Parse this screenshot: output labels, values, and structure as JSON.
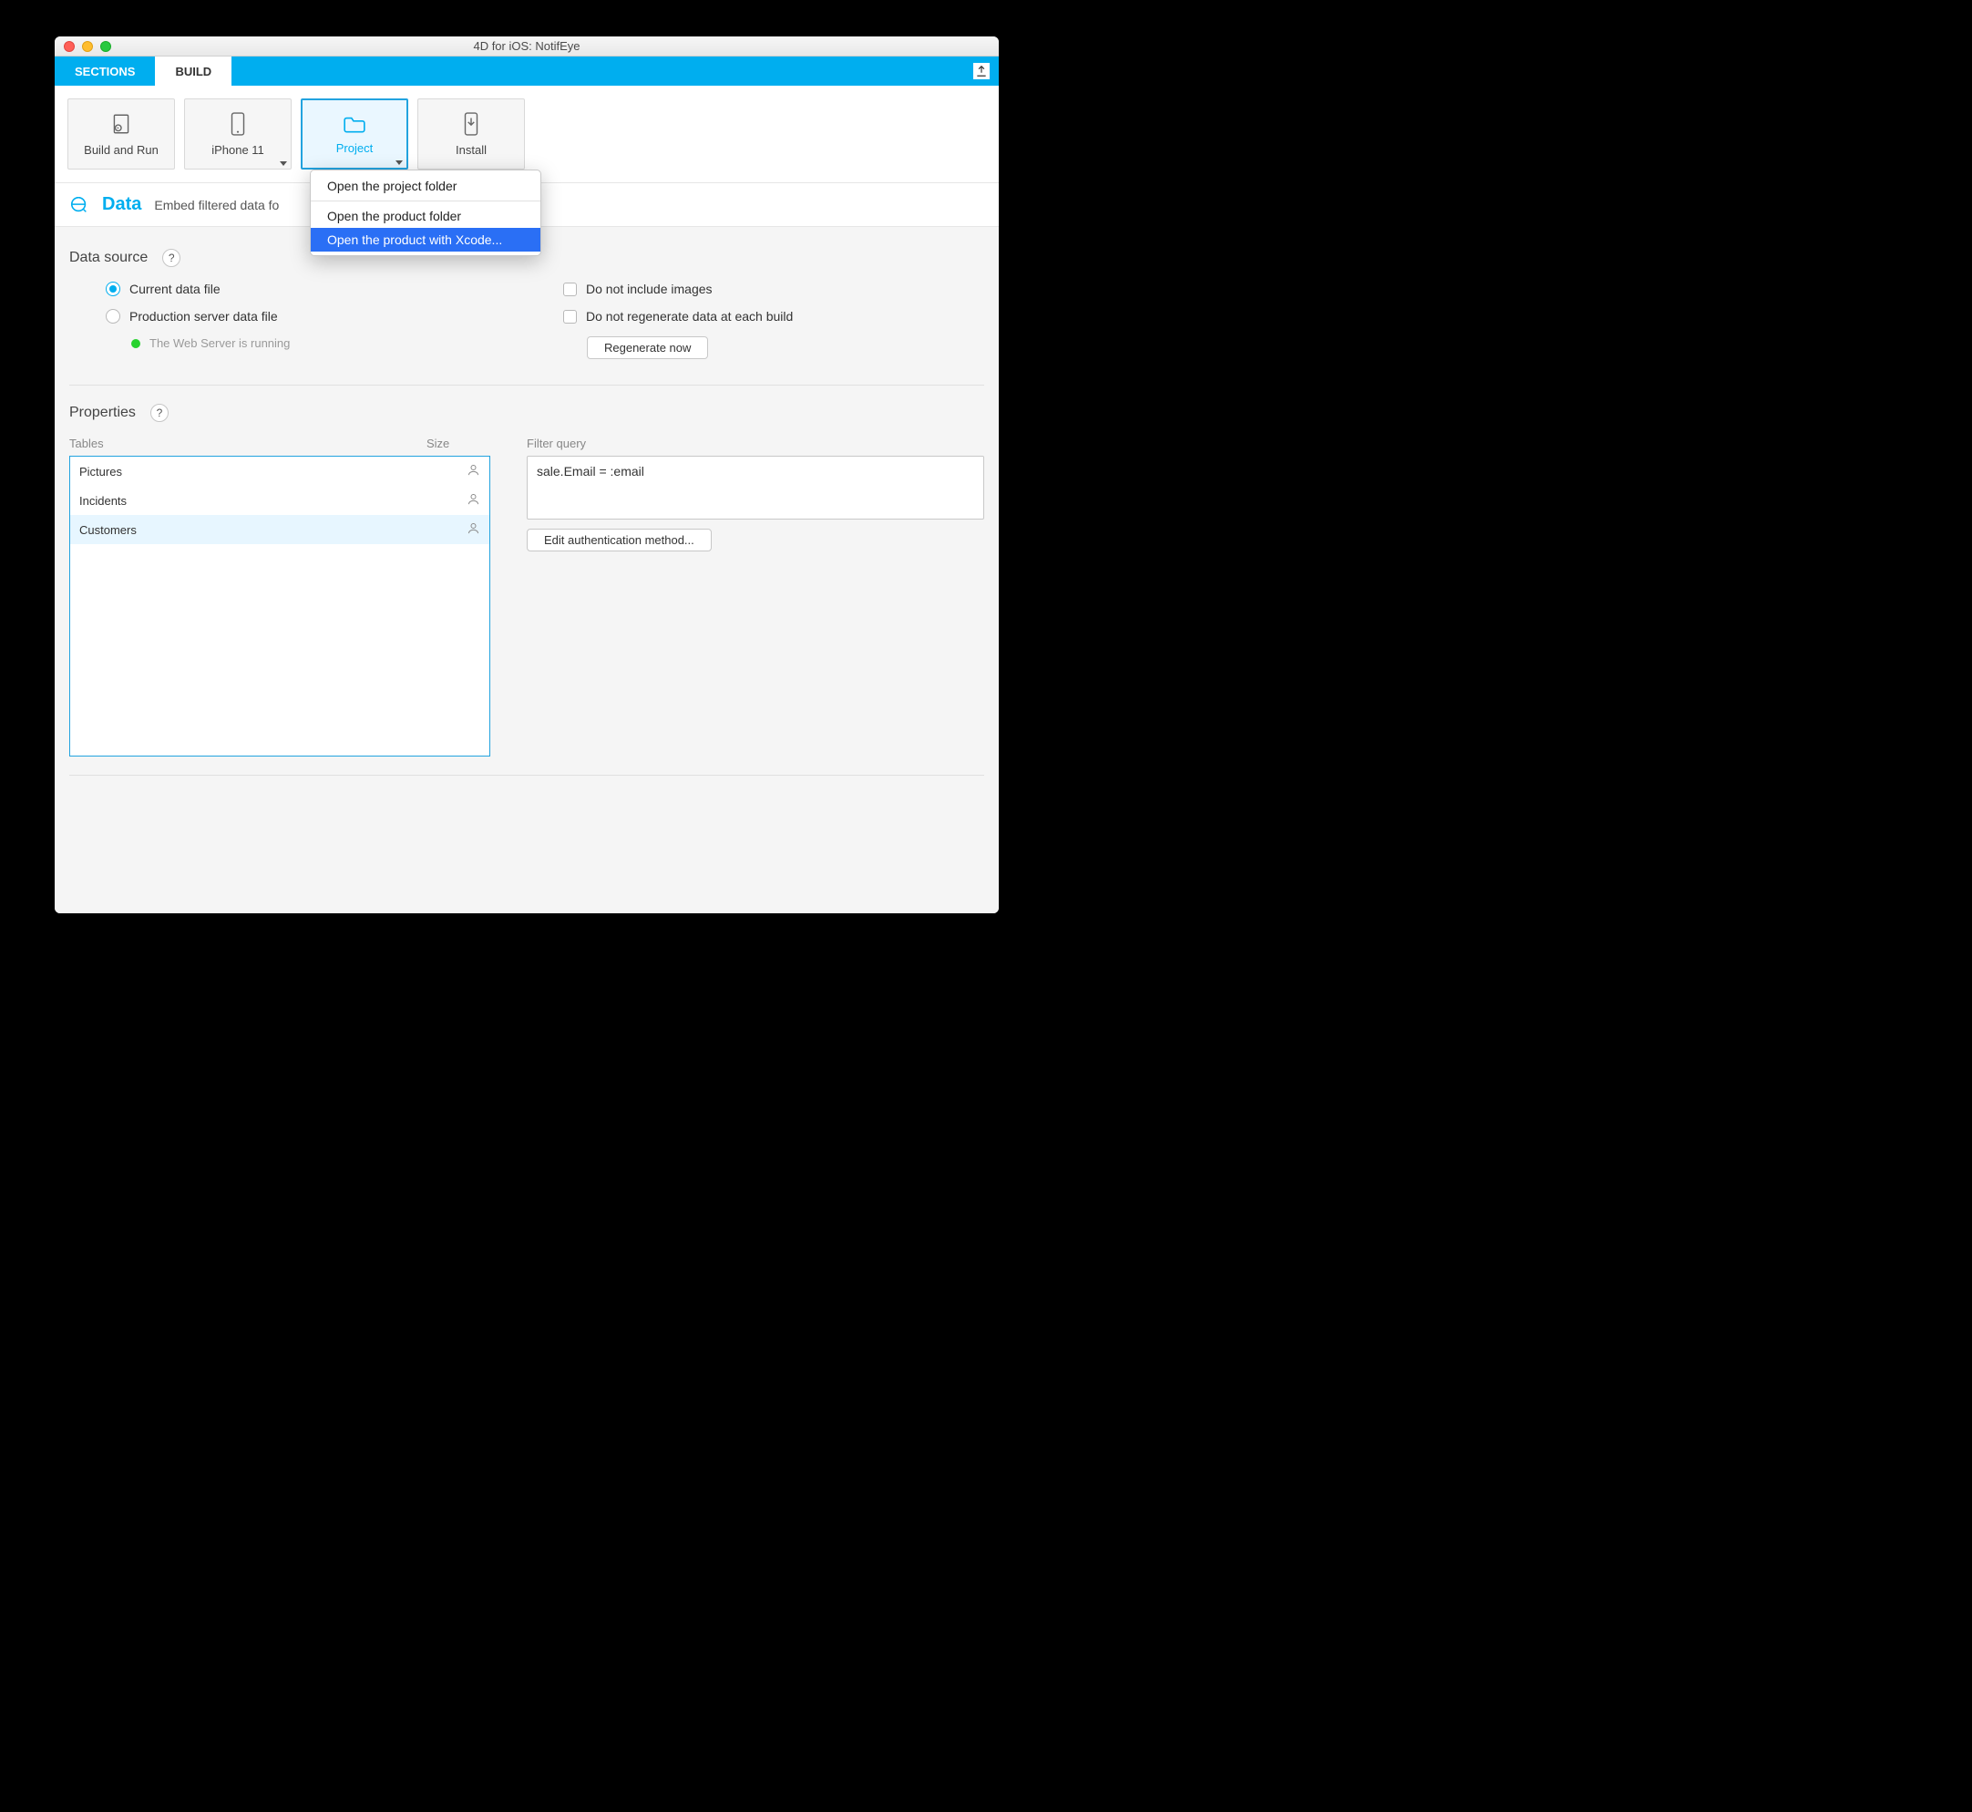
{
  "window": {
    "title": "4D for iOS: NotifEye"
  },
  "tabs": {
    "sections": "SECTIONS",
    "build": "BUILD"
  },
  "toolbar": {
    "build_run": "Build and Run",
    "device": "iPhone 11",
    "project": "Project",
    "install": "Install"
  },
  "project_menu": {
    "open_project_folder": "Open the project folder",
    "open_product_folder": "Open the product folder",
    "open_with_xcode": "Open the product with Xcode..."
  },
  "section": {
    "title": "Data",
    "subtitle": "Embed filtered data fo"
  },
  "data_source": {
    "header": "Data source",
    "current": "Current data file",
    "production": "Production server data file",
    "status": "The Web Server is running",
    "no_images": "Do not include images",
    "no_regen": "Do not regenerate data at each build",
    "regen_btn": "Regenerate now"
  },
  "properties": {
    "header": "Properties",
    "col_tables": "Tables",
    "col_size": "Size",
    "tables": [
      "Pictures",
      "Incidents",
      "Customers"
    ],
    "selected_index": 2,
    "filter_label": "Filter query",
    "filter_value": "sale.Email = :email",
    "auth_btn": "Edit authentication method..."
  }
}
